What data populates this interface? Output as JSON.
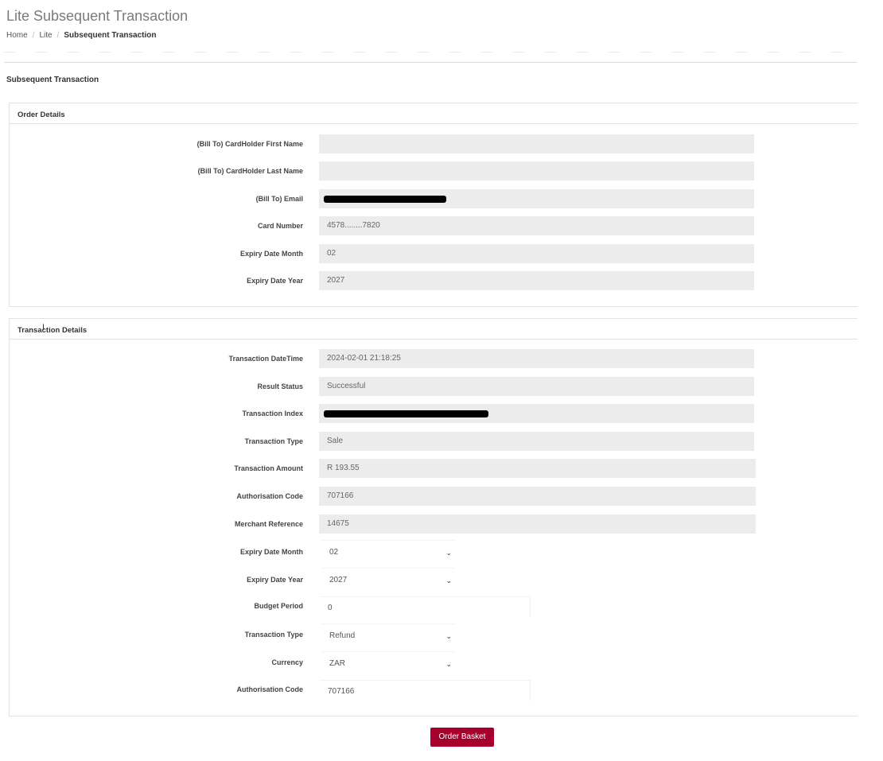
{
  "header": {
    "title": "Lite Subsequent Transaction",
    "breadcrumb": [
      "Home",
      "Lite",
      "Subsequent Transaction"
    ]
  },
  "section_title": "Subsequent Transaction",
  "order_details": {
    "title": "Order Details",
    "fields": [
      {
        "label": "(Bill To) CardHolder First Name",
        "value": ""
      },
      {
        "label": "(Bill To) CardHolder Last Name",
        "value": ""
      },
      {
        "label": "(Bill To) Email",
        "value": ""
      },
      {
        "label": "Card Number",
        "value": "4578........7820"
      },
      {
        "label": "Expiry Date Month",
        "value": "02"
      },
      {
        "label": "Expiry Date Year",
        "value": "2027"
      }
    ]
  },
  "transaction_details": {
    "title": "Transaction Details",
    "readonly_fields": [
      {
        "label": "Transaction DateTime",
        "value": "2024-02-01 21:18:25"
      },
      {
        "label": "Result Status",
        "value": "Successful"
      },
      {
        "label": "Transaction Index",
        "value": ""
      },
      {
        "label": "Transaction Type",
        "value": "Sale"
      },
      {
        "label": "Transaction Amount",
        "value": "R 193.55"
      },
      {
        "label": "Authorisation Code",
        "value": "707166"
      },
      {
        "label": "Merchant Reference",
        "value": "14675"
      }
    ],
    "editable_fields": [
      {
        "label": "Expiry Date Month",
        "value": "02"
      },
      {
        "label": "Expiry Date Year",
        "value": "2027"
      },
      {
        "label": "Budget Period",
        "value": "0"
      },
      {
        "label": "Transaction Type",
        "value": "Refund"
      },
      {
        "label": "Currency",
        "value": "ZAR"
      },
      {
        "label": "Authorisation Code",
        "value": "707166"
      }
    ]
  },
  "actions": {
    "order_basket": "Order Basket"
  },
  "colors": {
    "button_bg": "#a8002c",
    "readonly_field_bg": "#ececec"
  },
  "icons": {
    "select_arrow": "chevron-down-icon"
  }
}
